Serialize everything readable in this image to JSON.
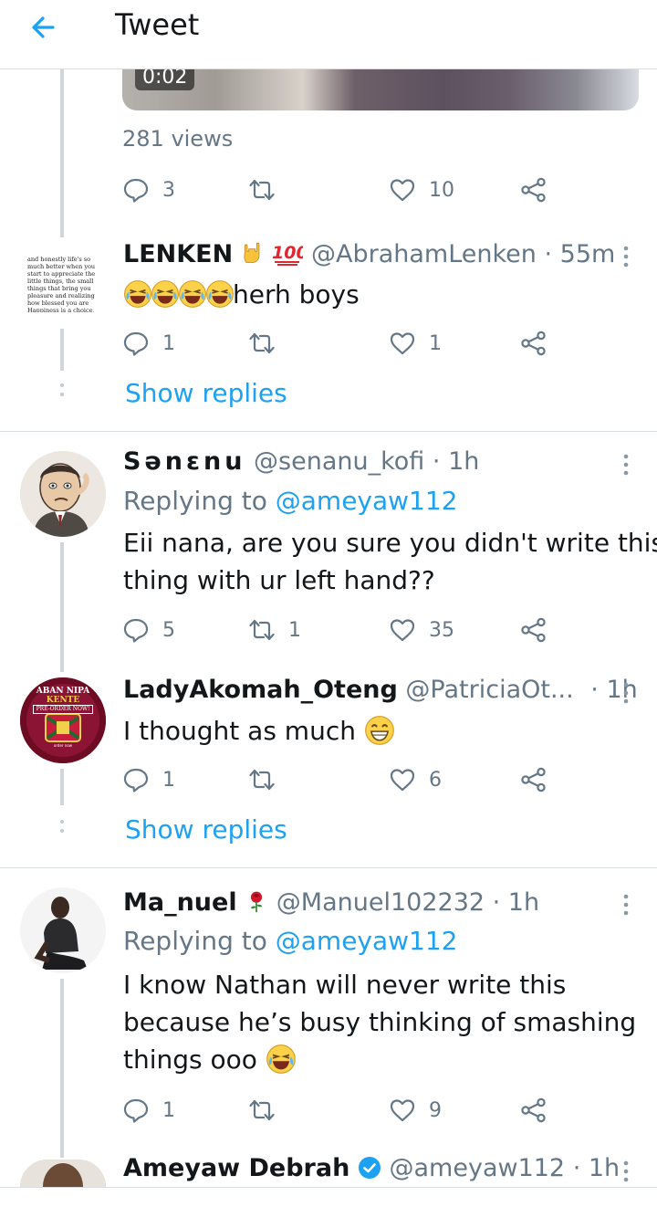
{
  "header": {
    "title": "Tweet"
  },
  "video": {
    "duration": "0:02"
  },
  "main_tweet": {
    "views": "281 views",
    "replies": "3",
    "retweets": "",
    "likes": "10"
  },
  "replies": [
    {
      "name": "LENKEN",
      "handle": "@AbrahamLenken",
      "time": "· 55m",
      "text": "herh boys",
      "reply_count": "1",
      "retweet_count": "",
      "like_count": "1",
      "show_replies": "Show replies",
      "avatar_quote": "and honestly life's so much better when you start to appreciate the little things, the small things that bring you pleasure and realizing how blessed you are Happiness is a choice, choose it."
    },
    {
      "name": "Sənɛnu",
      "handle": "@senanu_kofi",
      "time": "· 1h",
      "replying_label": "Replying to",
      "replying_handle": "@ameyaw112",
      "text_lines": [
        "Eii nana, are you sure you didn't write this",
        "thing with ur left hand??"
      ],
      "reply_count": "5",
      "retweet_count": "1",
      "like_count": "35"
    },
    {
      "name": "LadyAkomah_Oteng",
      "handle": "@PatriciaOt...",
      "time": "· 1h",
      "text": "I thought as much",
      "reply_count": "1",
      "retweet_count": "",
      "like_count": "6",
      "show_replies": "Show replies",
      "avatar_text": {
        "line1": "ABAN NIPA",
        "line2": "KENTE",
        "line3": "PRE-ORDER NOW!"
      }
    },
    {
      "name": "Ma_nuel",
      "handle": "@Manuel102232",
      "time": "· 1h",
      "replying_label": "Replying to",
      "replying_handle": "@ameyaw112",
      "text_lines": [
        "I know Nathan will never write this",
        "because he’s busy thinking of smashing",
        "things ooo"
      ],
      "reply_count": "1",
      "retweet_count": "",
      "like_count": "9"
    },
    {
      "name": "Ameyaw Debrah",
      "handle": "@ameyaw112",
      "time": "· 1h",
      "verified": true
    }
  ],
  "colors": {
    "accent": "#1da1f2",
    "muted": "#657786",
    "text": "#14171a",
    "divider": "#d8dde2"
  },
  "icons": [
    "back-arrow-icon",
    "reply-icon",
    "retweet-icon",
    "like-icon",
    "share-icon",
    "more-icon",
    "verified-icon",
    "laughing-emoji",
    "grinning-emoji",
    "rose-emoji",
    "hundred-emoji",
    "rock-on-emoji"
  ]
}
